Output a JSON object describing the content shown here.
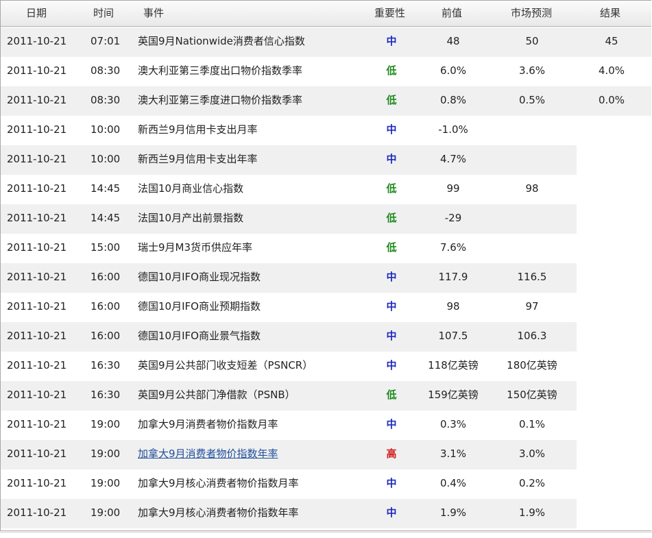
{
  "header": {
    "date": "日期",
    "time": "时间",
    "event": "事件",
    "importance": "重要性",
    "previous": "前值",
    "forecast": "市场预测",
    "result": "结果"
  },
  "colors": {
    "importance_mid": "#1e2bbf",
    "importance_low": "#1e8a1e",
    "importance_high": "#d11a1a",
    "row_shade": "#f0f0f0",
    "link": "#1f4e9c"
  },
  "rows": [
    {
      "date": "2011-10-21",
      "time": "07:01",
      "event": "英国9月Nationwide消费者信心指数",
      "importance": "中",
      "level": "mid",
      "previous": "48",
      "forecast": "50",
      "result": "45",
      "link": false
    },
    {
      "date": "2011-10-21",
      "time": "08:30",
      "event": "澳大利亚第三季度出口物价指数季率",
      "importance": "低",
      "level": "low",
      "previous": "6.0%",
      "forecast": "3.6%",
      "result": "4.0%",
      "link": false
    },
    {
      "date": "2011-10-21",
      "time": "08:30",
      "event": "澳大利亚第三季度进口物价指数季率",
      "importance": "低",
      "level": "low",
      "previous": "0.8%",
      "forecast": "0.5%",
      "result": "0.0%",
      "link": false
    },
    {
      "date": "2011-10-21",
      "time": "10:00",
      "event": "新西兰9月信用卡支出月率",
      "importance": "中",
      "level": "mid",
      "previous": "-1.0%",
      "forecast": "",
      "result": "",
      "link": false
    },
    {
      "date": "2011-10-21",
      "time": "10:00",
      "event": "新西兰9月信用卡支出年率",
      "importance": "中",
      "level": "mid",
      "previous": "4.7%",
      "forecast": "",
      "result": "",
      "link": false
    },
    {
      "date": "2011-10-21",
      "time": "14:45",
      "event": "法国10月商业信心指数",
      "importance": "低",
      "level": "low",
      "previous": "99",
      "forecast": "98",
      "result": "",
      "link": false
    },
    {
      "date": "2011-10-21",
      "time": "14:45",
      "event": "法国10月产出前景指数",
      "importance": "低",
      "level": "low",
      "previous": "-29",
      "forecast": "",
      "result": "",
      "link": false
    },
    {
      "date": "2011-10-21",
      "time": "15:00",
      "event": "瑞士9月M3货币供应年率",
      "importance": "低",
      "level": "low",
      "previous": "7.6%",
      "forecast": "",
      "result": "",
      "link": false
    },
    {
      "date": "2011-10-21",
      "time": "16:00",
      "event": "德国10月IFO商业现况指数",
      "importance": "中",
      "level": "mid",
      "previous": "117.9",
      "forecast": "116.5",
      "result": "",
      "link": false
    },
    {
      "date": "2011-10-21",
      "time": "16:00",
      "event": "德国10月IFO商业预期指数",
      "importance": "中",
      "level": "mid",
      "previous": "98",
      "forecast": "97",
      "result": "",
      "link": false
    },
    {
      "date": "2011-10-21",
      "time": "16:00",
      "event": "德国10月IFO商业景气指数",
      "importance": "中",
      "level": "mid",
      "previous": "107.5",
      "forecast": "106.3",
      "result": "",
      "link": false
    },
    {
      "date": "2011-10-21",
      "time": "16:30",
      "event": "英国9月公共部门收支短差（PSNCR）",
      "importance": "中",
      "level": "mid",
      "previous": "118亿英镑",
      "forecast": "180亿英镑",
      "result": "",
      "link": false
    },
    {
      "date": "2011-10-21",
      "time": "16:30",
      "event": "英国9月公共部门净借款（PSNB）",
      "importance": "低",
      "level": "low",
      "previous": "159亿英镑",
      "forecast": "150亿英镑",
      "result": "",
      "link": false
    },
    {
      "date": "2011-10-21",
      "time": "19:00",
      "event": "加拿大9月消费者物价指数月率",
      "importance": "中",
      "level": "mid",
      "previous": "0.3%",
      "forecast": "0.1%",
      "result": "",
      "link": false
    },
    {
      "date": "2011-10-21",
      "time": "19:00",
      "event": "加拿大9月消费者物价指数年率",
      "importance": "高",
      "level": "high",
      "previous": "3.1%",
      "forecast": "3.0%",
      "result": "",
      "link": true
    },
    {
      "date": "2011-10-21",
      "time": "19:00",
      "event": "加拿大9月核心消费者物价指数月率",
      "importance": "中",
      "level": "mid",
      "previous": "0.4%",
      "forecast": "0.2%",
      "result": "",
      "link": false
    },
    {
      "date": "2011-10-21",
      "time": "19:00",
      "event": "加拿大9月核心消费者物价指数年率",
      "importance": "中",
      "level": "mid",
      "previous": "1.9%",
      "forecast": "1.9%",
      "result": "",
      "link": false
    }
  ]
}
